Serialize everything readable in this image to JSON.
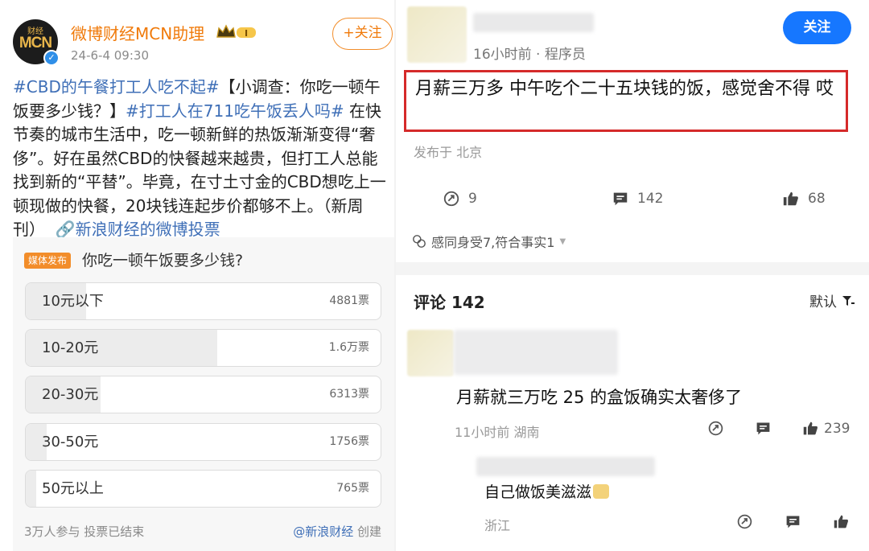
{
  "left": {
    "avatar_text": "MCN",
    "avatar_sub": "财经",
    "account_name": "微博财经MCN助理",
    "post_time": "24-6-4 09:30",
    "follow_label": "+关注",
    "post": {
      "tag1": "#CBD的午餐打工人吃不起#",
      "text1": "【小调查：你吃一顿午饭要多少钱？】",
      "tag2": "#打工人在711吃午饭丢人吗#",
      "text2": " 在快节奏的城市生活中，吃一顿新鲜的热饭渐渐变得“奢侈”。好在虽然CBD的快餐越来越贵，但打工人总能找到新的“平替”。毕竟，在寸土寸金的CBD想吃上一顿现做的快餐，20块钱连起步价都够不上。（新周刊）",
      "link": "🔗新浪财经的微博投票"
    },
    "poll": {
      "badge": "媒体发布",
      "question": "你吃一顿午饭要多少钱?",
      "options": [
        {
          "label": "10元以下",
          "votes": "4881票",
          "share": 0.17
        },
        {
          "label": "10-20元",
          "votes": "1.6万票",
          "share": 0.54
        },
        {
          "label": "20-30元",
          "votes": "6313票",
          "share": 0.21
        },
        {
          "label": "30-50元",
          "votes": "1756票",
          "share": 0.06
        },
        {
          "label": "50元以上",
          "votes": "765票",
          "share": 0.03
        }
      ],
      "footer": "3万人参与  投票已结束",
      "creator_at": "@新浪财经",
      "creator_suffix": " 创建"
    }
  },
  "right": {
    "meta": "16小时前 · 程序员",
    "follow_label": "关注",
    "highlight": "月薪三万多 中午吃个二十五块钱的饭，感觉舍不得 哎",
    "location": "发布于 北京",
    "actions": {
      "forward": "9",
      "comment": "142",
      "like": "68"
    },
    "related": "感同身受7,符合事实1",
    "comments_title": "评论 142",
    "sort_label": "默认",
    "comment1": {
      "text": "月薪就三万吃 25 的盒饭确实太奢侈了",
      "meta": "11小时前  湖南",
      "likes": "239"
    },
    "reply": {
      "text": "自己做饭美滋滋",
      "location": "浙江"
    },
    "colors": {
      "follow_blue": "#1677ff",
      "highlight_red": "#d52a2a"
    }
  }
}
